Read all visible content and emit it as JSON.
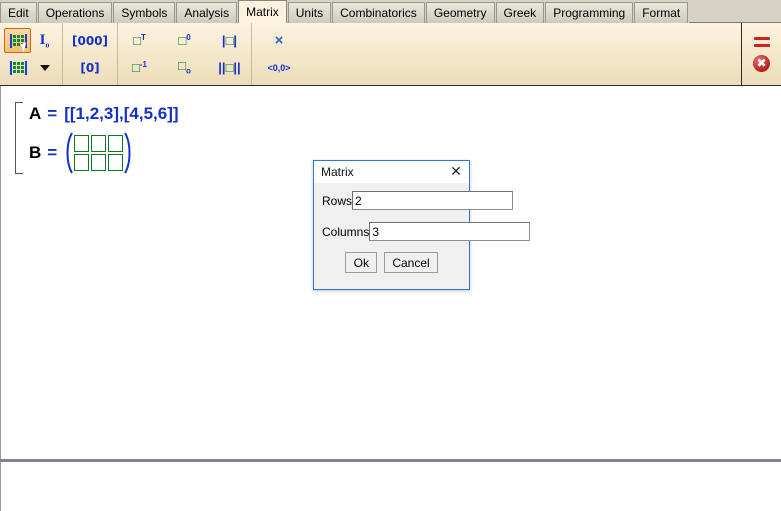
{
  "window": {
    "tabs": [
      {
        "label": "Edit",
        "active": false
      },
      {
        "label": "Operations",
        "active": false
      },
      {
        "label": "Symbols",
        "active": false
      },
      {
        "label": "Analysis",
        "active": false
      },
      {
        "label": "Matrix",
        "active": true
      },
      {
        "label": "Units",
        "active": false
      },
      {
        "label": "Combinatorics",
        "active": false
      },
      {
        "label": "Geometry",
        "active": false
      },
      {
        "label": "Greek",
        "active": false
      },
      {
        "label": "Programming",
        "active": false
      },
      {
        "label": "Format",
        "active": false
      }
    ]
  },
  "toolbar": {
    "groups": [
      {
        "name": "insert-group",
        "buttons": [
          {
            "icon": "matrix-insert-icon",
            "label": "",
            "selected": true
          },
          {
            "icon": "identity-matrix-icon",
            "label": "I",
            "sublabel": "o",
            "selected": false
          },
          {
            "icon": "matrix-grid-icon",
            "label": "",
            "selected": false
          },
          {
            "icon": "dropdown-caret-icon",
            "label": "",
            "selected": false
          }
        ]
      },
      {
        "name": "vector-group",
        "buttons": [
          {
            "icon": "row-vector-icon",
            "label": "[000]",
            "selected": false
          },
          {
            "icon": "column-vector-icon",
            "label": "[0]",
            "selected": false
          }
        ]
      },
      {
        "name": "operator-group",
        "buttons": [
          {
            "icon": "transpose-icon",
            "label": "T",
            "selected": false
          },
          {
            "icon": "matrix-power-icon",
            "label": "0",
            "selected": false
          },
          {
            "icon": "determinant-icon",
            "label": "|0|",
            "selected": false
          },
          {
            "icon": "matrix-inverse-icon",
            "label": "-1",
            "selected": false
          },
          {
            "icon": "matrix-subscript-icon",
            "label": "o",
            "selected": false
          },
          {
            "icon": "norm-icon",
            "label": "||0||",
            "selected": false
          }
        ]
      },
      {
        "name": "product-group",
        "buttons": [
          {
            "icon": "cross-product-icon",
            "label": "×",
            "selected": false
          },
          {
            "icon": "vector-coordinates-icon",
            "label": "<0,0>",
            "selected": false
          }
        ]
      }
    ],
    "right": [
      {
        "icon": "equals-red-icon",
        "label": ""
      },
      {
        "icon": "close-red-circle-icon",
        "label": ""
      }
    ]
  },
  "worksheet": {
    "lines": [
      {
        "name": "assignment-A",
        "variable": "A",
        "equals": "=",
        "value": "[[1,2,3],[4,5,6]]",
        "type": "text"
      },
      {
        "name": "assignment-B",
        "variable": "B",
        "equals": "=",
        "value": "",
        "type": "matrix",
        "rows": 2,
        "columns": 3
      }
    ]
  },
  "dialog": {
    "title": "Matrix",
    "close_label": "✕",
    "fields": [
      {
        "name": "rows",
        "label": "Rows",
        "value": "2",
        "placeholder": ""
      },
      {
        "name": "columns",
        "label": "Columns",
        "value": "3",
        "placeholder": ""
      }
    ],
    "buttons": [
      {
        "name": "ok",
        "label": "Ok"
      },
      {
        "name": "cancel",
        "label": "Cancel"
      }
    ]
  },
  "colors": {
    "accent_blue": "#1430c8",
    "placeholder_green": "#0a7a24",
    "tab_active_bg": "#fdf2df",
    "toolbar_bg": "#f5e9d0",
    "dialog_border": "#2e7ad1",
    "close_red": "#b82020"
  }
}
